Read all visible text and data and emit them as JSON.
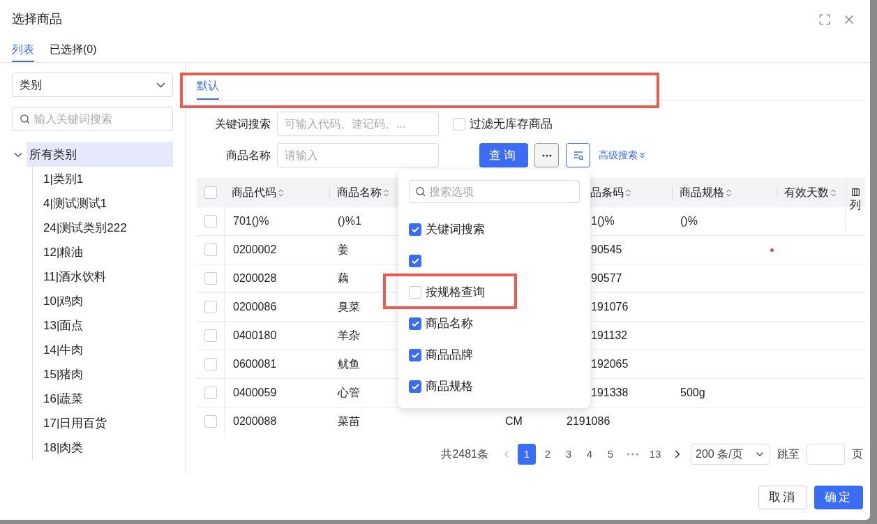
{
  "window": {
    "title": "选择商品"
  },
  "tabs": [
    {
      "label": "列表",
      "selected": true
    },
    {
      "label": "已选择(0)",
      "selected": false
    }
  ],
  "sidebar": {
    "category_select": "类别",
    "search": {
      "placeholder": "输入关键词搜索"
    },
    "tree": [
      {
        "label": "所有类别",
        "expanded": true,
        "selected": true,
        "children": [
          {
            "label": "1|类别1",
            "selected": false
          },
          {
            "label": "4|测试测试1",
            "selected": false
          },
          {
            "label": "24|测试类别222",
            "selected": false
          },
          {
            "label": "12|粮油",
            "selected": false
          },
          {
            "label": "11|酒水饮料",
            "selected": false
          },
          {
            "label": "10|鸡肉",
            "selected": false
          },
          {
            "label": "13|面点",
            "selected": false
          },
          {
            "label": "14|牛肉",
            "selected": false
          },
          {
            "label": "15|猪肉",
            "selected": false
          },
          {
            "label": "16|蔬菜",
            "selected": false
          },
          {
            "label": "17|日用百货",
            "selected": false
          },
          {
            "label": "18|肉类",
            "selected": false
          }
        ]
      }
    ]
  },
  "view_tabs": [
    {
      "label": "默认",
      "selected": true,
      "highlighted": true
    }
  ],
  "filters": {
    "keyword": {
      "label": "关键词搜索",
      "placeholder": "可输入代码、速记码、..."
    },
    "no_stock": {
      "label": "过滤无库存商品",
      "checked": false
    },
    "name": {
      "label": "商品名称",
      "placeholder": "请输入"
    },
    "query_button": "查询",
    "advanced_link": "高级搜索"
  },
  "table": {
    "all_checked": false,
    "columns": [
      "商品代码",
      "商品名称",
      null,
      "品条码",
      "商品规格",
      "有效天数"
    ],
    "column_settings": "列",
    "rows": [
      {
        "checked": false,
        "flag": false,
        "cells": [
          "701()%",
          "()%1",
          null,
          "1()%",
          "()%",
          null
        ]
      },
      {
        "checked": false,
        "flag": true,
        "cells": [
          "0200002",
          "姜",
          null,
          "90545",
          null,
          null
        ]
      },
      {
        "checked": false,
        "flag": false,
        "cells": [
          "0200028",
          "藕",
          null,
          "90577",
          null,
          null
        ]
      },
      {
        "checked": false,
        "flag": false,
        "cells": [
          "0200086",
          "臭菜",
          null,
          "191076",
          null,
          null
        ]
      },
      {
        "checked": false,
        "flag": false,
        "cells": [
          "0400180",
          "羊杂",
          null,
          "191132",
          null,
          null
        ]
      },
      {
        "checked": false,
        "flag": false,
        "cells": [
          "0600081",
          "鱿鱼",
          null,
          "192065",
          null,
          null
        ]
      },
      {
        "checked": false,
        "flag": false,
        "cells": [
          "0400059",
          "心管",
          null,
          "191338",
          "500g",
          null
        ]
      },
      {
        "checked": false,
        "flag": false,
        "cells": [
          "0200088",
          "菜苗",
          "CM",
          "2191086",
          null,
          null
        ]
      }
    ]
  },
  "dropdown": {
    "search": {
      "placeholder": "搜索选项"
    },
    "options": [
      {
        "label": "关键词搜索",
        "checked": true
      },
      {
        "checked": true
      },
      {
        "label": "按规格查询",
        "checked": false,
        "highlighted": true
      },
      {
        "label": "商品名称",
        "checked": true
      },
      {
        "label": "商品品牌",
        "checked": true
      },
      {
        "label": "商品规格",
        "checked": true
      }
    ]
  },
  "pagination": {
    "total": "共2481条",
    "pages": [
      {
        "label": "1",
        "selected": true
      },
      {
        "label": "2",
        "selected": false
      },
      {
        "label": "3",
        "selected": false
      },
      {
        "label": "4",
        "selected": false
      },
      {
        "label": "5",
        "selected": false
      },
      {
        "label": "13",
        "selected": false
      }
    ],
    "page_size": "200 条/页",
    "jump_label": "跳至",
    "page_unit": "页"
  },
  "buttons": {
    "cancel": "取消",
    "confirm": "确定"
  }
}
